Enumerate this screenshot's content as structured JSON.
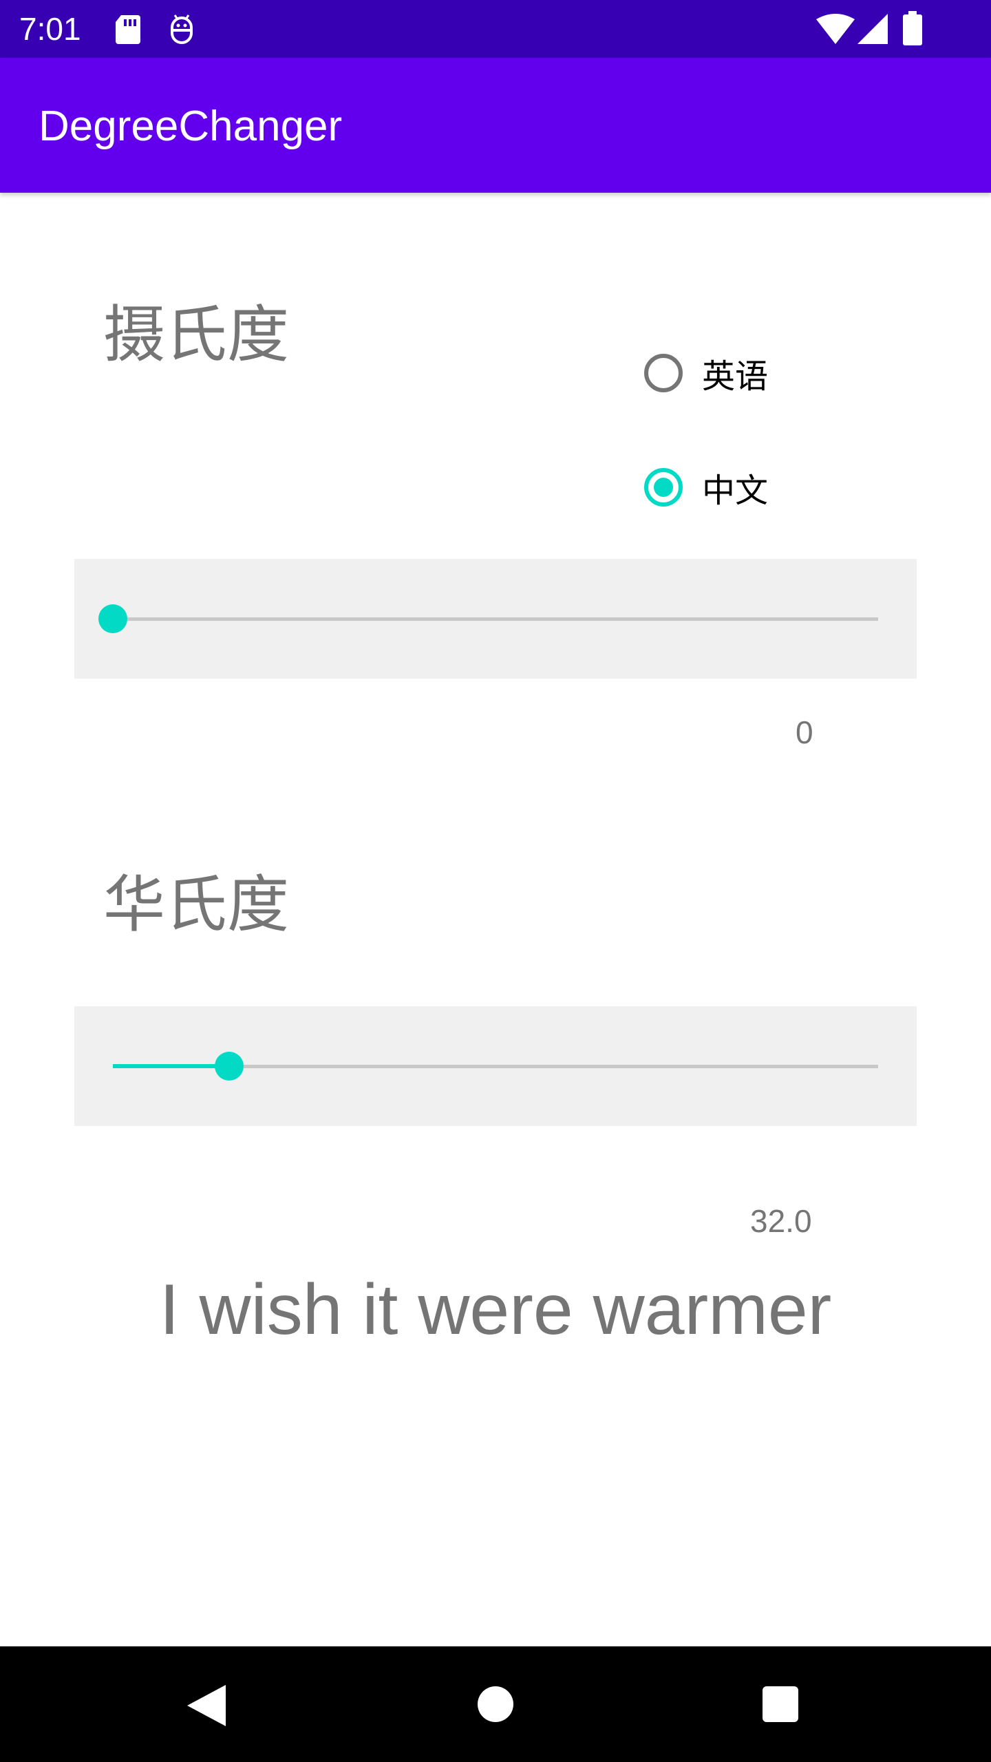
{
  "status_bar": {
    "time": "7:01",
    "icons": [
      "sd-card-icon",
      "android-debug-icon",
      "wifi-icon",
      "signal-icon",
      "battery-icon"
    ]
  },
  "app_bar": {
    "title": "DegreeChanger"
  },
  "celsius": {
    "label": "摄氏度",
    "value": "0",
    "slider_fraction": 0.0
  },
  "language": {
    "options": [
      {
        "label": "英语",
        "checked": false
      },
      {
        "label": "中文",
        "checked": true
      }
    ]
  },
  "fahrenheit": {
    "label": "华氏度",
    "value": "32.0",
    "slider_fraction": 0.152
  },
  "message": "I wish it were warmer",
  "colors": {
    "status_bar": "#3700b3",
    "app_bar": "#6200ee",
    "accent": "#03dac5",
    "slider_background": "#f0f0f0",
    "secondary_text": "#757575"
  },
  "nav_bar": {
    "icons": [
      "back-icon",
      "home-icon",
      "recents-icon"
    ]
  }
}
